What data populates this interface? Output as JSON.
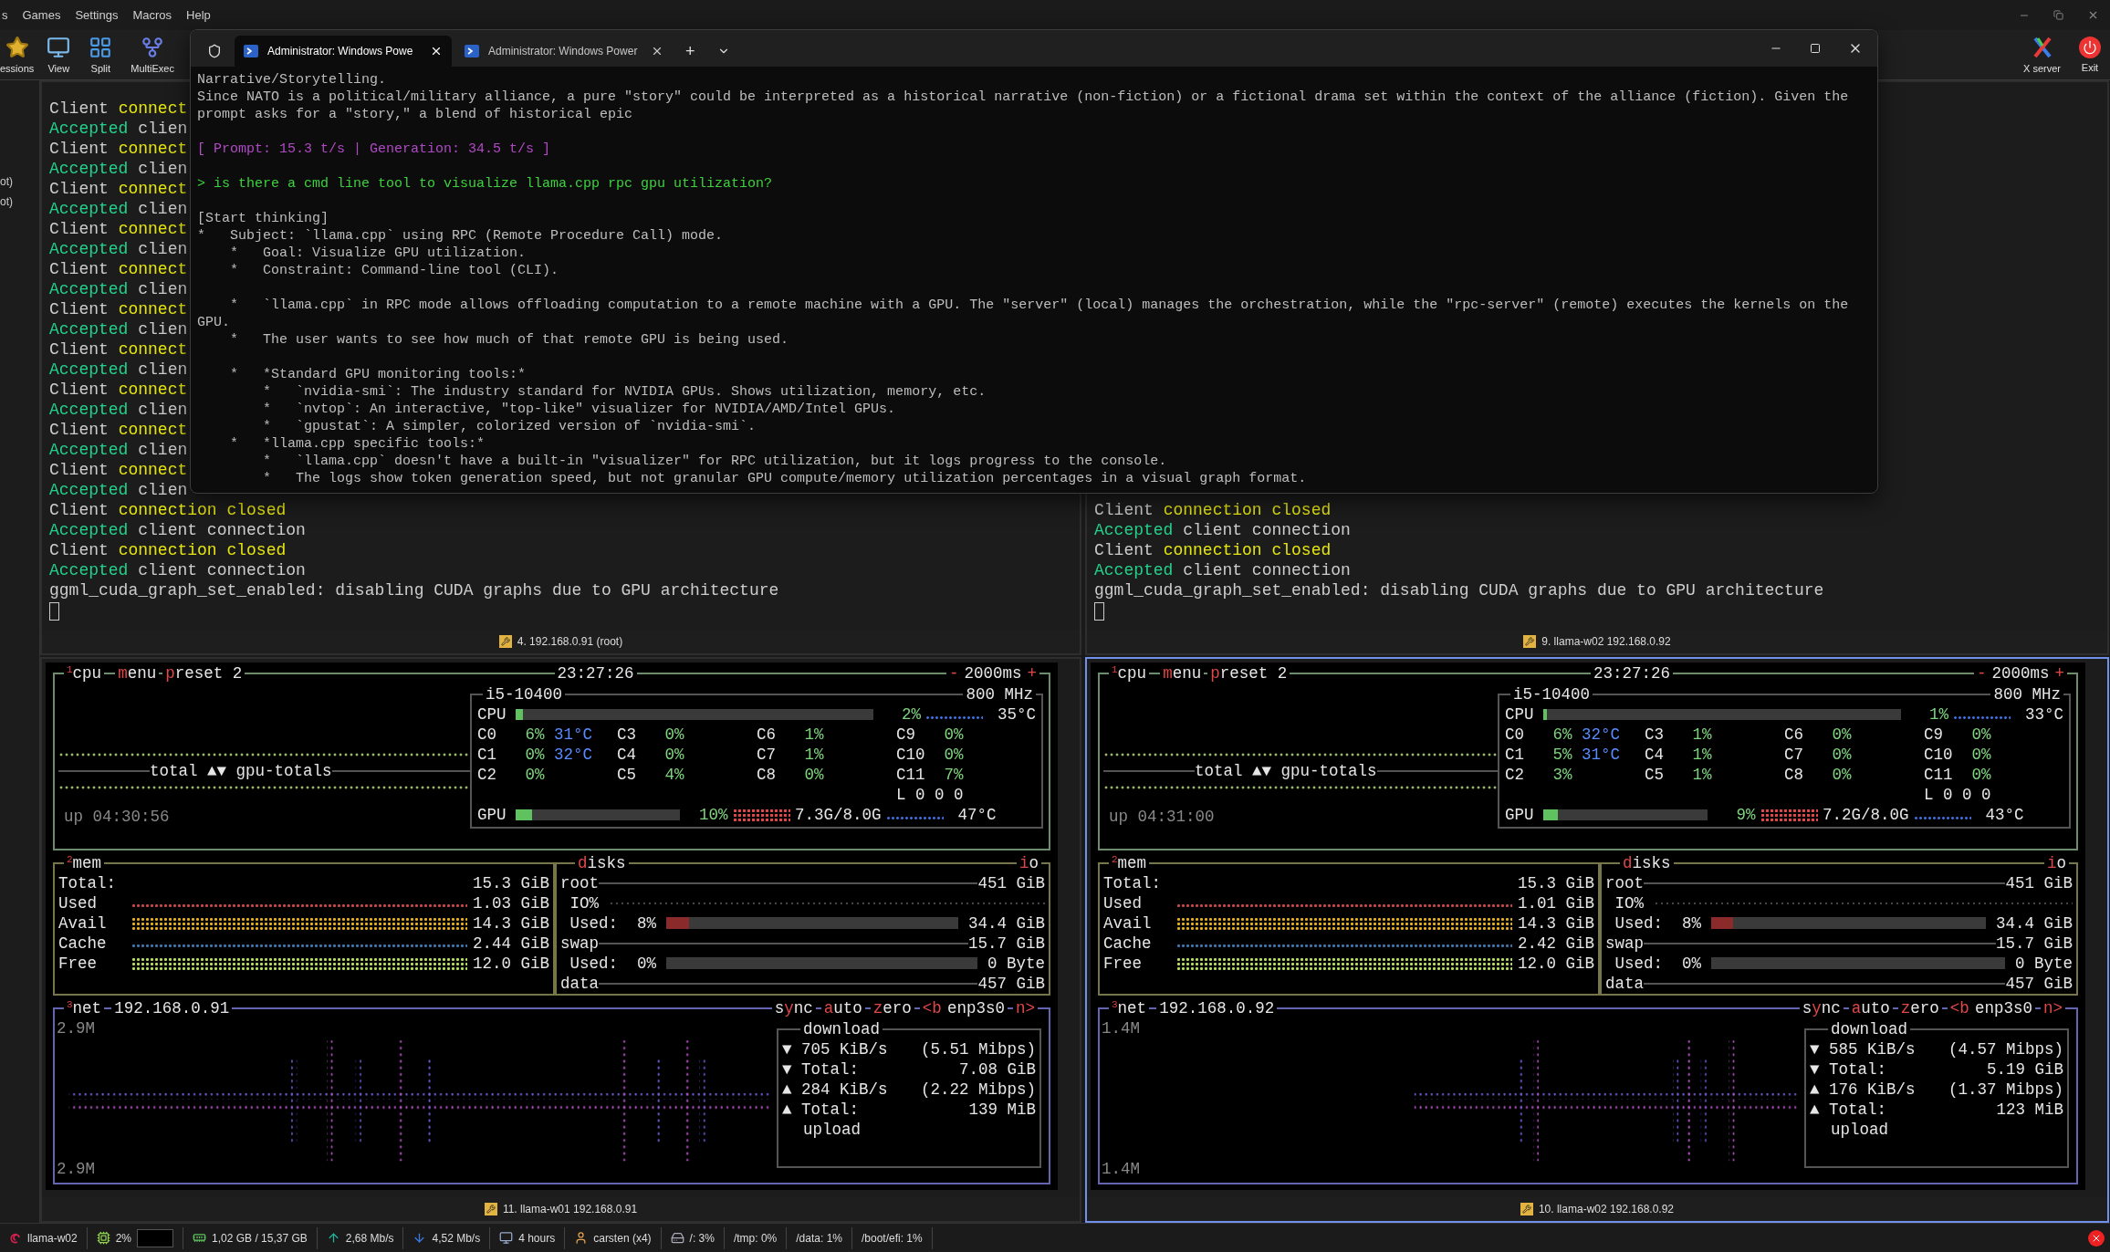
{
  "menu_bar": {
    "items": [
      "s",
      "Games",
      "Settings",
      "Macros",
      "Help"
    ]
  },
  "toolbar": {
    "left": [
      {
        "kind": "star",
        "label": "essions"
      },
      {
        "kind": "monitor",
        "label": "View"
      },
      {
        "kind": "grid",
        "label": "Split"
      },
      {
        "kind": "fork",
        "label": "MultiExec"
      }
    ],
    "right": [
      {
        "kind": "xlogo",
        "label": "X server"
      },
      {
        "kind": "power",
        "label": "Exit"
      }
    ]
  },
  "sidebar": {
    "items": [
      "ot)",
      "ot)"
    ]
  },
  "panes": [
    {
      "kind": "terminal",
      "selected": false,
      "footer": "4. 192.168.0.91 (root)",
      "lines": [
        {
          "segments": [
            {
              "kind": "normal",
              "text": "Client"
            },
            {
              "kind": "warn",
              "text": "connect"
            }
          ]
        },
        {
          "segments": [
            {
              "kind": "ok",
              "text": "Accepted"
            },
            {
              "kind": "normal",
              "text": "clien"
            }
          ]
        },
        {
          "segments": [
            {
              "kind": "normal",
              "text": "Client"
            },
            {
              "kind": "warn",
              "text": "connect"
            }
          ]
        },
        {
          "segments": [
            {
              "kind": "ok",
              "text": "Accepted"
            },
            {
              "kind": "normal",
              "text": "clien"
            }
          ]
        },
        {
          "segments": [
            {
              "kind": "normal",
              "text": "Client"
            },
            {
              "kind": "warn",
              "text": "connect"
            }
          ]
        },
        {
          "segments": [
            {
              "kind": "ok",
              "text": "Accepted"
            },
            {
              "kind": "normal",
              "text": "clien"
            }
          ]
        },
        {
          "segments": [
            {
              "kind": "normal",
              "text": "Client"
            },
            {
              "kind": "warn",
              "text": "connect"
            }
          ]
        },
        {
          "segments": [
            {
              "kind": "ok",
              "text": "Accepted"
            },
            {
              "kind": "normal",
              "text": "clien"
            }
          ]
        },
        {
          "segments": [
            {
              "kind": "normal",
              "text": "Client"
            },
            {
              "kind": "warn",
              "text": "connect"
            }
          ]
        },
        {
          "segments": [
            {
              "kind": "ok",
              "text": "Accepted"
            },
            {
              "kind": "normal",
              "text": "clien"
            }
          ]
        },
        {
          "segments": [
            {
              "kind": "normal",
              "text": "Client"
            },
            {
              "kind": "warn",
              "text": "connect"
            }
          ]
        },
        {
          "segments": [
            {
              "kind": "ok",
              "text": "Accepted"
            },
            {
              "kind": "normal",
              "text": "clien"
            }
          ]
        },
        {
          "segments": [
            {
              "kind": "normal",
              "text": "Client"
            },
            {
              "kind": "warn",
              "text": "connect"
            }
          ]
        },
        {
          "segments": [
            {
              "kind": "ok",
              "text": "Accepted"
            },
            {
              "kind": "normal",
              "text": "clien"
            }
          ]
        },
        {
          "segments": [
            {
              "kind": "normal",
              "text": "Client"
            },
            {
              "kind": "warn",
              "text": "connect"
            }
          ]
        },
        {
          "segments": [
            {
              "kind": "ok",
              "text": "Accepted"
            },
            {
              "kind": "normal",
              "text": "clien"
            }
          ]
        },
        {
          "segments": [
            {
              "kind": "normal",
              "text": "Client"
            },
            {
              "kind": "warn",
              "text": "connect"
            }
          ]
        },
        {
          "segments": [
            {
              "kind": "ok",
              "text": "Accepted"
            },
            {
              "kind": "normal",
              "text": "clien"
            }
          ]
        },
        {
          "segments": [
            {
              "kind": "normal",
              "text": "Client"
            },
            {
              "kind": "warn",
              "text": "connect"
            }
          ]
        },
        {
          "segments": [
            {
              "kind": "ok",
              "text": "Accepted"
            },
            {
              "kind": "normal",
              "text": "clien"
            }
          ]
        },
        {
          "segments": [
            {
              "kind": "normal",
              "text": "Client"
            },
            {
              "kind": "warn",
              "text": "connection closed"
            }
          ]
        },
        {
          "segments": [
            {
              "kind": "ok",
              "text": "Accepted"
            },
            {
              "kind": "normal",
              "text": "client connection"
            }
          ]
        },
        {
          "segments": [
            {
              "kind": "normal",
              "text": "Client"
            },
            {
              "kind": "warn",
              "text": "connection closed"
            }
          ]
        },
        {
          "segments": [
            {
              "kind": "ok",
              "text": "Accepted"
            },
            {
              "kind": "normal",
              "text": "client connection"
            }
          ]
        },
        {
          "segments": [
            {
              "kind": "normal",
              "text": "ggml_cuda_graph_set_enabled: disabling CUDA graphs due to GPU architecture"
            }
          ]
        }
      ]
    },
    {
      "kind": "terminal",
      "selected": false,
      "footer": "9. llama-w02 192.168.0.92",
      "lines": [
        {
          "segments": [
            {
              "kind": "normal",
              "text": "Client"
            },
            {
              "kind": "warn",
              "text": "connection closed"
            }
          ]
        },
        {
          "segments": [
            {
              "kind": "ok",
              "text": "Accepted"
            },
            {
              "kind": "normal",
              "text": "client connection"
            }
          ]
        },
        {
          "segments": [
            {
              "kind": "normal",
              "text": "Client"
            },
            {
              "kind": "warn",
              "text": "connection closed"
            }
          ]
        },
        {
          "segments": [
            {
              "kind": "ok",
              "text": "Accepted"
            },
            {
              "kind": "normal",
              "text": "client connection"
            }
          ]
        },
        {
          "segments": [
            {
              "kind": "normal",
              "text": "ggml_cuda_graph_set_enabled: disabling CUDA graphs due to GPU architecture"
            }
          ]
        }
      ]
    },
    {
      "kind": "btop",
      "selected": false,
      "footer": "11. llama-w01 192.168.0.91",
      "btop": {
        "cpu": {
          "title": "$^{1}$cpu",
          "menu": {
            "hot": "m",
            "after": "enu"
          },
          "preset": {
            "hot": "p",
            "after": "reset 2"
          },
          "clock": "23:27:26",
          "minus": "-",
          "interval": "2000ms",
          "plus": "+",
          "graph_label": "total ▲▼ gpu-totals",
          "uptime": "up 04:30:56",
          "model": "i5-10400",
          "freq": "800 MHz",
          "total": {
            "label": "CPU",
            "level": 0.02,
            "percent": "2%",
            "temp": "35°C"
          },
          "cores": [
            {
              "name": "C0",
              "percent": "6%",
              "temp": "31°C"
            },
            {
              "name": "C1",
              "percent": "0%",
              "temp": "32°C"
            },
            {
              "name": "C2",
              "percent": "0%"
            },
            {
              "name": "C3",
              "percent": "0%"
            },
            {
              "name": "C4",
              "percent": "0%"
            },
            {
              "name": "C5",
              "percent": "4%"
            },
            {
              "name": "C6",
              "percent": "1%"
            },
            {
              "name": "C7",
              "percent": "1%"
            },
            {
              "name": "C8",
              "percent": "0%"
            },
            {
              "name": "C9",
              "percent": "0%"
            },
            {
              "name": "C10",
              "percent": "0%"
            },
            {
              "name": "C11",
              "percent": "7%"
            }
          ],
          "load": "L 0 0 0",
          "gpu": {
            "label": "GPU",
            "level": 0.1,
            "percent": "10%",
            "memory": "7.3G/8.0G",
            "temp": "47°C"
          }
        },
        "mem": {
          "title": "$^{2}$mem",
          "rows": [
            {
              "label": "Total:",
              "value": "15.3 GiB"
            },
            {
              "label": "Used",
              "value": "1.03 GiB",
              "kind": "sparse",
              "color": "#c84848"
            },
            {
              "label": "Avail",
              "value": "14.3 GiB",
              "kind": "dense",
              "color": "#e8b020"
            },
            {
              "label": "Cache",
              "value": "2.44 GiB",
              "kind": "sparse",
              "color": "#3f75a8"
            },
            {
              "label": "Free",
              "value": "12.0 GiB",
              "kind": "dense",
              "color": "#b8e060"
            }
          ]
        },
        "disks": {
          "title": {
            "hot": "d",
            "after": "isks"
          },
          "io": {
            "hot": "i",
            "after": "o"
          },
          "rows": [
            {
              "kind": "mount",
              "label": "root",
              "value": "451 GiB"
            },
            {
              "kind": "io",
              "label": "IO%"
            },
            {
              "kind": "used",
              "label": "Used:",
              "percent": "8%",
              "level": 0.08,
              "value": "34.4 GiB"
            },
            {
              "kind": "mount",
              "label": "swap",
              "value": "15.7 GiB"
            },
            {
              "kind": "used",
              "label": "Used:",
              "percent": "0%",
              "value": "0 Byte"
            },
            {
              "kind": "mount",
              "label": "data",
              "value": "457 GiB"
            }
          ]
        },
        "net": {
          "title": "$^{3}$net",
          "address": "192.168.0.91",
          "controls": [
            {
              "before": "s",
              "hot": "y",
              "after": "nc"
            },
            {
              "hot": "a",
              "after": "uto"
            },
            {
              "hot": "z",
              "after": "ero"
            },
            {
              "hot": "<b"
            },
            {
              "after": "enp3s0"
            },
            {
              "hot": "n>"
            }
          ],
          "scale_top": "2.9M",
          "scale_bottom": "2.9M",
          "download_title": "download",
          "upload_title": "upload",
          "stats": [
            {
              "arrow": "▼",
              "label": "705 KiB/s",
              "value": "(5.51 Mibps)"
            },
            {
              "arrow": "▼",
              "label": "Total:",
              "value": "7.08 GiB"
            },
            {
              "arrow": "▲",
              "label": "284 KiB/s",
              "value": "(2.22 Mibps)"
            },
            {
              "arrow": "▲",
              "label": "Total:",
              "value": "139 MiB"
            }
          ]
        }
      }
    },
    {
      "kind": "btop",
      "selected": true,
      "footer": "10. llama-w02 192.168.0.92",
      "btop": {
        "cpu": {
          "title": "$^{1}$cpu",
          "menu": {
            "hot": "m",
            "after": "enu"
          },
          "preset": {
            "hot": "p",
            "after": "reset 2"
          },
          "clock": "23:27:26",
          "minus": "-",
          "interval": "2000ms",
          "plus": "+",
          "graph_label": "total ▲▼ gpu-totals",
          "uptime": "up 04:31:00",
          "model": "i5-10400",
          "freq": "800 MHz",
          "total": {
            "label": "CPU",
            "level": 0.01,
            "percent": "1%",
            "temp": "33°C"
          },
          "cores": [
            {
              "name": "C0",
              "percent": "6%",
              "temp": "32°C"
            },
            {
              "name": "C1",
              "percent": "5%",
              "temp": "31°C"
            },
            {
              "name": "C2",
              "percent": "3%"
            },
            {
              "name": "C3",
              "percent": "1%"
            },
            {
              "name": "C4",
              "percent": "1%"
            },
            {
              "name": "C5",
              "percent": "1%"
            },
            {
              "name": "C6",
              "percent": "0%"
            },
            {
              "name": "C7",
              "percent": "0%"
            },
            {
              "name": "C8",
              "percent": "0%"
            },
            {
              "name": "C9",
              "percent": "0%"
            },
            {
              "name": "C10",
              "percent": "0%"
            },
            {
              "name": "C11",
              "percent": "0%"
            }
          ],
          "load": "L 0 0 0",
          "gpu": {
            "label": "GPU",
            "level": 0.09,
            "percent": "9%",
            "memory": "7.2G/8.0G",
            "temp": "43°C"
          }
        },
        "mem": {
          "title": "$^{2}$mem",
          "rows": [
            {
              "label": "Total:",
              "value": "15.3 GiB"
            },
            {
              "label": "Used",
              "value": "1.01 GiB",
              "kind": "sparse",
              "color": "#c84848"
            },
            {
              "label": "Avail",
              "value": "14.3 GiB",
              "kind": "dense",
              "color": "#e8b020"
            },
            {
              "label": "Cache",
              "value": "2.42 GiB",
              "kind": "sparse",
              "color": "#3f75a8"
            },
            {
              "label": "Free",
              "value": "12.0 GiB",
              "kind": "dense",
              "color": "#b8e060"
            }
          ]
        },
        "disks": {
          "title": {
            "hot": "d",
            "after": "isks"
          },
          "io": {
            "hot": "i",
            "after": "o"
          },
          "rows": [
            {
              "kind": "mount",
              "label": "root",
              "value": "451 GiB"
            },
            {
              "kind": "io",
              "label": "IO%"
            },
            {
              "kind": "used",
              "label": "Used:",
              "percent": "8%",
              "level": 0.08,
              "value": "34.4 GiB"
            },
            {
              "kind": "mount",
              "label": "swap",
              "value": "15.7 GiB"
            },
            {
              "kind": "used",
              "label": "Used:",
              "percent": "0%",
              "value": "0 Byte"
            },
            {
              "kind": "mount",
              "label": "data",
              "value": "457 GiB"
            }
          ]
        },
        "net": {
          "title": "$^{3}$net",
          "address": "192.168.0.92",
          "controls": [
            {
              "before": "s",
              "hot": "y",
              "after": "nc"
            },
            {
              "hot": "a",
              "after": "uto"
            },
            {
              "hot": "z",
              "after": "ero"
            },
            {
              "hot": "<b"
            },
            {
              "after": "enp3s0"
            },
            {
              "hot": "n>"
            }
          ],
          "scale_top": "1.4M",
          "scale_bottom": "1.4M",
          "download_title": "download",
          "upload_title": "upload",
          "stats": [
            {
              "arrow": "▼",
              "label": "585 KiB/s",
              "value": "(4.57 Mibps)"
            },
            {
              "arrow": "▼",
              "label": "Total:",
              "value": "5.19 GiB"
            },
            {
              "arrow": "▲",
              "label": "176 KiB/s",
              "value": "(1.37 Mibps)"
            },
            {
              "arrow": "▲",
              "label": "Total:",
              "value": "123 MiB"
            }
          ]
        }
      }
    }
  ],
  "terminal_window": {
    "tabs": [
      {
        "title": "Administrator: Windows Powe",
        "selected": true
      },
      {
        "title": "Administrator: Windows Power",
        "selected": false
      }
    ],
    "new_tab": "+",
    "lines": [
      {
        "kind": "text",
        "text": "Narrative/Storytelling."
      },
      {
        "kind": "text",
        "text": "Since NATO is a political/military alliance, a pure \"story\" could be interpreted as a historical narrative (non-fiction) or a fictional drama set within the context of the alliance (fiction). Given the"
      },
      {
        "kind": "text",
        "text": "prompt asks for a \"story,\" a blend of historical epic"
      },
      {
        "kind": "blank"
      },
      {
        "kind": "stats",
        "text": "[ Prompt: 15.3 t/s | Generation: 34.5 t/s ]"
      },
      {
        "kind": "blank"
      },
      {
        "kind": "prompt",
        "text": "> is there a cmd line tool to visualize llama.cpp rpc gpu utilization?"
      },
      {
        "kind": "blank"
      },
      {
        "kind": "text",
        "text": "[Start thinking]"
      },
      {
        "kind": "text",
        "text": "*   Subject: `llama.cpp` using RPC (Remote Procedure Call) mode."
      },
      {
        "kind": "text",
        "text": "    *   Goal: Visualize GPU utilization."
      },
      {
        "kind": "text",
        "text": "    *   Constraint: Command-line tool (CLI)."
      },
      {
        "kind": "blank"
      },
      {
        "kind": "text",
        "text": "    *   `llama.cpp` in RPC mode allows offloading computation to a remote machine with a GPU. The \"server\" (local) manages the orchestration, while the \"rpc-server\" (remote) executes the kernels on the"
      },
      {
        "kind": "text",
        "text": "GPU."
      },
      {
        "kind": "text",
        "text": "    *   The user wants to see how much of that remote GPU is being used."
      },
      {
        "kind": "blank"
      },
      {
        "kind": "text",
        "text": "    *   *Standard GPU monitoring tools:*"
      },
      {
        "kind": "text",
        "text": "        *   `nvidia-smi`: The industry standard for NVIDIA GPUs. Shows utilization, memory, etc."
      },
      {
        "kind": "text",
        "text": "        *   `nvtop`: An interactive, \"top-like\" visualizer for NVIDIA/AMD/Intel GPUs."
      },
      {
        "kind": "text",
        "text": "        *   `gpustat`: A simpler, colorized version of `nvidia-smi`."
      },
      {
        "kind": "text",
        "text": "    *   *llama.cpp specific tools:*"
      },
      {
        "kind": "text",
        "text": "        *   `llama.cpp` doesn't have a built-in \"visualizer\" for RPC utilization, but it logs progress to the console."
      },
      {
        "kind": "text",
        "text": "        *   The logs show token generation speed, but not granular GPU compute/memory utilization percentages in a visual graph format."
      }
    ]
  },
  "status_bar": {
    "items": [
      {
        "kind": "host",
        "text": "llama-w02"
      },
      {
        "kind": "cpu",
        "text": "2%"
      },
      {
        "kind": "ram",
        "text": "1,02 GB / 15,37 GB"
      },
      {
        "kind": "upload",
        "text": "2,68 Mb/s"
      },
      {
        "kind": "download",
        "text": "4,52 Mb/s"
      },
      {
        "kind": "uptime",
        "text": "4 hours"
      },
      {
        "kind": "user",
        "text": "carsten (x4)"
      },
      {
        "kind": "disk",
        "text": "/: 3%"
      },
      {
        "kind": "plain",
        "text": "/tmp: 0%"
      },
      {
        "kind": "plain",
        "text": "/data: 1%"
      },
      {
        "kind": "plain",
        "text": "/boot/efi: 1%"
      }
    ]
  }
}
